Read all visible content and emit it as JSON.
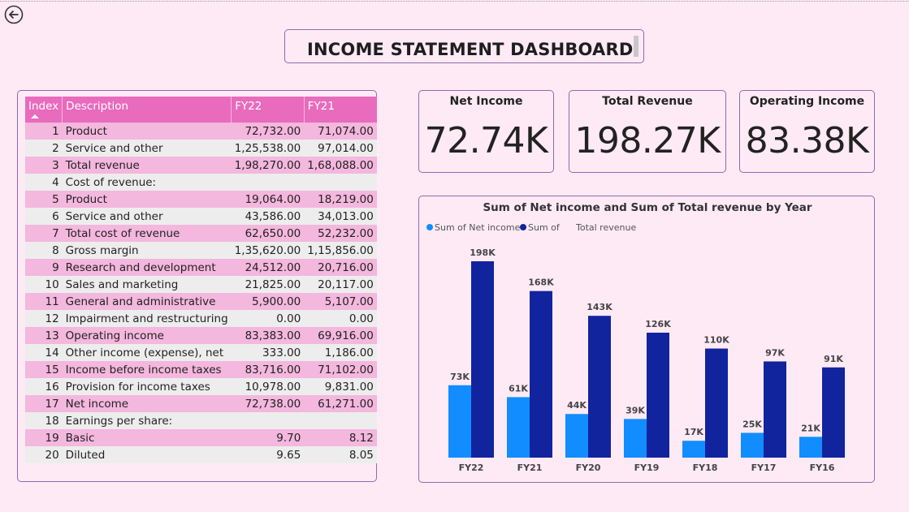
{
  "dashboard": {
    "title": "INCOME STATEMENT DASHBOARD"
  },
  "table": {
    "headers": [
      "Index",
      "Description",
      "FY22",
      "FY21"
    ],
    "sort_column": "Index",
    "rows": [
      {
        "index": "1",
        "description": "Product",
        "fy22": "72,732.00",
        "fy21": "71,074.00"
      },
      {
        "index": "2",
        "description": "Service and other",
        "fy22": "1,25,538.00",
        "fy21": "97,014.00"
      },
      {
        "index": "3",
        "description": "Total revenue",
        "fy22": "1,98,270.00",
        "fy21": "1,68,088.00"
      },
      {
        "index": "4",
        "description": "Cost of revenue:",
        "fy22": "",
        "fy21": ""
      },
      {
        "index": "5",
        "description": "Product",
        "fy22": "19,064.00",
        "fy21": "18,219.00"
      },
      {
        "index": "6",
        "description": "Service and other",
        "fy22": "43,586.00",
        "fy21": "34,013.00"
      },
      {
        "index": "7",
        "description": "Total cost of revenue",
        "fy22": "62,650.00",
        "fy21": "52,232.00"
      },
      {
        "index": "8",
        "description": "Gross margin",
        "fy22": "1,35,620.00",
        "fy21": "1,15,856.00"
      },
      {
        "index": "9",
        "description": "Research and development",
        "fy22": "24,512.00",
        "fy21": "20,716.00"
      },
      {
        "index": "10",
        "description": "Sales and marketing",
        "fy22": "21,825.00",
        "fy21": "20,117.00"
      },
      {
        "index": "11",
        "description": "General and administrative",
        "fy22": "5,900.00",
        "fy21": "5,107.00"
      },
      {
        "index": "12",
        "description": "Impairment and restructuring",
        "fy22": "0.00",
        "fy21": "0.00"
      },
      {
        "index": "13",
        "description": "Operating income",
        "fy22": "83,383.00",
        "fy21": "69,916.00"
      },
      {
        "index": "14",
        "description": "Other income (expense), net",
        "fy22": "333.00",
        "fy21": "1,186.00"
      },
      {
        "index": "15",
        "description": "Income before income taxes",
        "fy22": "83,716.00",
        "fy21": "71,102.00"
      },
      {
        "index": "16",
        "description": "Provision for income taxes",
        "fy22": "10,978.00",
        "fy21": "9,831.00"
      },
      {
        "index": "17",
        "description": "Net income",
        "fy22": "72,738.00",
        "fy21": "61,271.00"
      },
      {
        "index": "18",
        "description": "Earnings per share:",
        "fy22": "",
        "fy21": ""
      },
      {
        "index": "19",
        "description": "Basic",
        "fy22": "9.70",
        "fy21": "8.12"
      },
      {
        "index": "20",
        "description": "Diluted",
        "fy22": "9.65",
        "fy21": "8.05"
      }
    ]
  },
  "kpis": [
    {
      "label": "Net Income",
      "value": "72.74K"
    },
    {
      "label": "Total Revenue",
      "value": "198.27K"
    },
    {
      "label": "Operating Income",
      "value": "83.38K"
    }
  ],
  "icons": {
    "back": "back-arrow-circle-icon"
  },
  "colors": {
    "background": "#fdeaf4",
    "header_pink": "#e86bbd",
    "row_pink": "#f4b7dd",
    "row_gray": "#ededed",
    "border_purple": "#8e6bb0",
    "net_income_bar": "#118dff",
    "total_revenue_bar": "#12239e"
  },
  "chart_data": {
    "type": "bar",
    "title": "Sum of Net income and Sum of Total revenue by Year",
    "categories": [
      "FY22",
      "FY21",
      "FY20",
      "FY19",
      "FY18",
      "FY17",
      "FY16"
    ],
    "series": [
      {
        "name": "Sum of Net income",
        "values": [
          73,
          61,
          44,
          39,
          17,
          25,
          21
        ],
        "labels": [
          "73K",
          "61K",
          "44K",
          "39K",
          "17K",
          "25K",
          "21K"
        ],
        "color": "#118dff"
      },
      {
        "name": "Sum of Total revenue",
        "values": [
          198,
          168,
          143,
          126,
          110,
          97,
          91
        ],
        "labels": [
          "198K",
          "168K",
          "143K",
          "126K",
          "110K",
          "97K",
          "91K"
        ],
        "color": "#12239e"
      }
    ],
    "legend_items": [
      "Sum of Net income",
      "Sum of",
      "Total revenue"
    ],
    "legend_position": "top-left",
    "ylim": [
      0,
      200
    ],
    "grid": false
  }
}
